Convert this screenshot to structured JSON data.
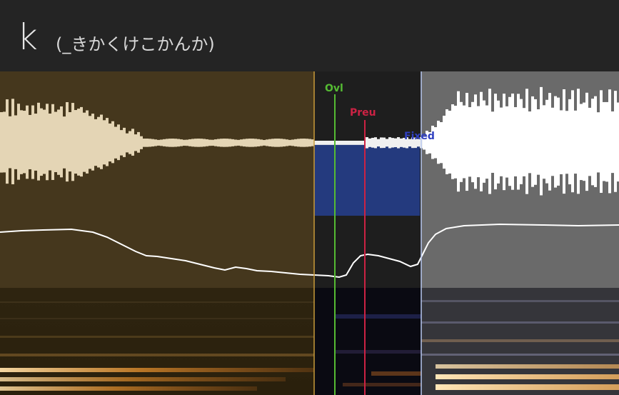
{
  "header": {
    "phoneme": "k",
    "alias": "(_きかくけこかんか)"
  },
  "markers": {
    "overlap": {
      "label": "Ovl",
      "color": "#55bb33"
    },
    "preutterance": {
      "label": "Preu",
      "color": "#cc2244"
    },
    "fixed": {
      "label": "Fixed",
      "color": "#2f3fbf"
    }
  },
  "regions": {
    "offset_color": "#45371d",
    "consonant_color": "#243a7e",
    "cutoff_color": "#6a6a6a"
  }
}
